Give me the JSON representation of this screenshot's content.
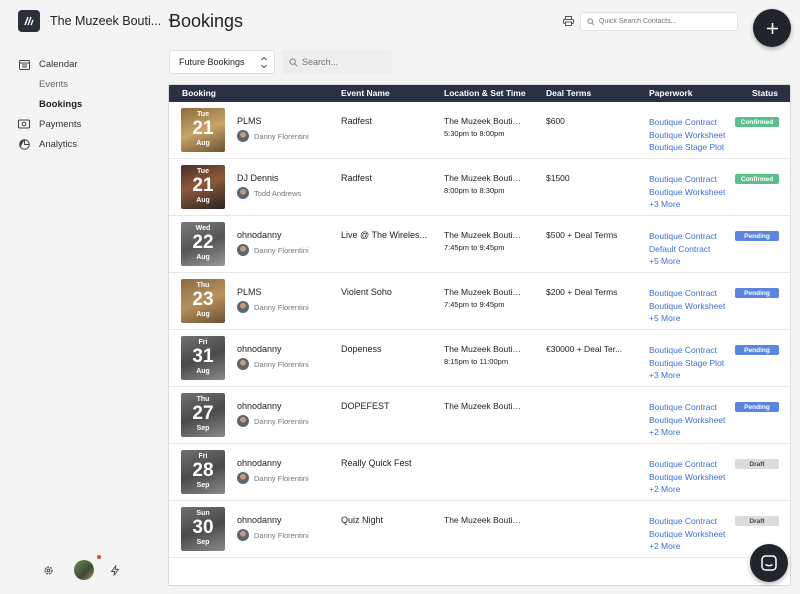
{
  "app": {
    "brand_name": "The Muzeek Bouti...",
    "page_title": "Bookings",
    "quick_search_placeholder": "Quick Search Contacts...",
    "colors": {
      "header": "#2b3145",
      "link": "#3b6fd6",
      "confirmed": "#5cbf8b",
      "pending": "#5b86e0",
      "draft": "#dcdcdc"
    }
  },
  "sidebar": {
    "items": [
      {
        "label": "Calendar",
        "icon": "calendar-icon"
      },
      {
        "label": "Events"
      },
      {
        "label": "Bookings",
        "active": true
      },
      {
        "label": "Payments",
        "icon": "payments-icon"
      },
      {
        "label": "Analytics",
        "icon": "analytics-icon"
      }
    ],
    "bottom_icons": [
      "gear-icon",
      "avatar",
      "lightning-icon"
    ]
  },
  "filters": {
    "select_value": "Future Bookings",
    "search_placeholder": "Search..."
  },
  "table": {
    "headers": [
      "Booking",
      "Event Name",
      "Location & Set Time",
      "Deal Terms",
      "Paperwork",
      "Status"
    ],
    "rows": [
      {
        "dow": "Tue",
        "day": "21",
        "mon": "Aug",
        "artist": "PLMS",
        "agent": "Danny Florentini",
        "event": "Radfest",
        "location": "The Muzeek Boutiq...",
        "time": "5:30pm to 8:00pm",
        "terms": "$600",
        "paperwork": [
          "Boutique Contract",
          "Boutique Worksheet",
          "Boutique Stage Plot"
        ],
        "status": "Confirmed"
      },
      {
        "dow": "Tue",
        "day": "21",
        "mon": "Aug",
        "artist": "DJ Dennis",
        "agent": "Todd Andrews",
        "event": "Radfest",
        "location": "The Muzeek Boutiq...",
        "time": "8:00pm to 8:30pm",
        "terms": "$1500",
        "paperwork": [
          "Boutique Contract",
          "Boutique Worksheet",
          "+3 More"
        ],
        "status": "Confirmed"
      },
      {
        "dow": "Wed",
        "day": "22",
        "mon": "Aug",
        "artist": "ohnodanny",
        "agent": "Danny Florentini",
        "event": "Live @ The Wireles...",
        "location": "The Muzeek Boutiq...",
        "time": "7:45pm to 9:45pm",
        "terms": "$500 + Deal Terms",
        "paperwork": [
          "Boutique Contract",
          "Default Contract",
          "+5 More"
        ],
        "status": "Pending"
      },
      {
        "dow": "Thu",
        "day": "23",
        "mon": "Aug",
        "artist": "PLMS",
        "agent": "Danny Florentini",
        "event": "Violent Soho",
        "location": "The Muzeek Boutiq...",
        "time": "7:45pm to 9:45pm",
        "terms": "$200 + Deal Terms",
        "paperwork": [
          "Boutique Contract",
          "Boutique Worksheet",
          "+5 More"
        ],
        "status": "Pending"
      },
      {
        "dow": "Fri",
        "day": "31",
        "mon": "Aug",
        "artist": "ohnodanny",
        "agent": "Danny Florentini",
        "event": "Dopeness",
        "location": "The Muzeek Boutiq...",
        "time": "8:15pm to 11:00pm",
        "terms": "€30000 + Deal Ter...",
        "paperwork": [
          "Boutique Contract",
          "Boutique Stage Plot",
          "+3 More"
        ],
        "status": "Pending"
      },
      {
        "dow": "Thu",
        "day": "27",
        "mon": "Sep",
        "artist": "ohnodanny",
        "agent": "Danny Florentini",
        "event": "DOPEFEST",
        "location": "The Muzeek Boutiq...",
        "time": "",
        "terms": "",
        "paperwork": [
          "Boutique Contract",
          "Boutique Worksheet",
          "+2 More"
        ],
        "status": "Pending"
      },
      {
        "dow": "Fri",
        "day": "28",
        "mon": "Sep",
        "artist": "ohnodanny",
        "agent": "Danny Florentini",
        "event": "Really Quick Fest",
        "location": "",
        "time": "",
        "terms": "",
        "paperwork": [
          "Boutique Contract",
          "Boutique Worksheet",
          "+2 More"
        ],
        "status": "Draft"
      },
      {
        "dow": "Sun",
        "day": "30",
        "mon": "Sep",
        "artist": "ohnodanny",
        "agent": "Danny Florentini",
        "event": "Quiz Night",
        "location": "The Muzeek Boutiq...",
        "time": "",
        "terms": "",
        "paperwork": [
          "Boutique Contract",
          "Boutique Worksheet",
          "+2 More"
        ],
        "status": "Draft"
      }
    ]
  }
}
